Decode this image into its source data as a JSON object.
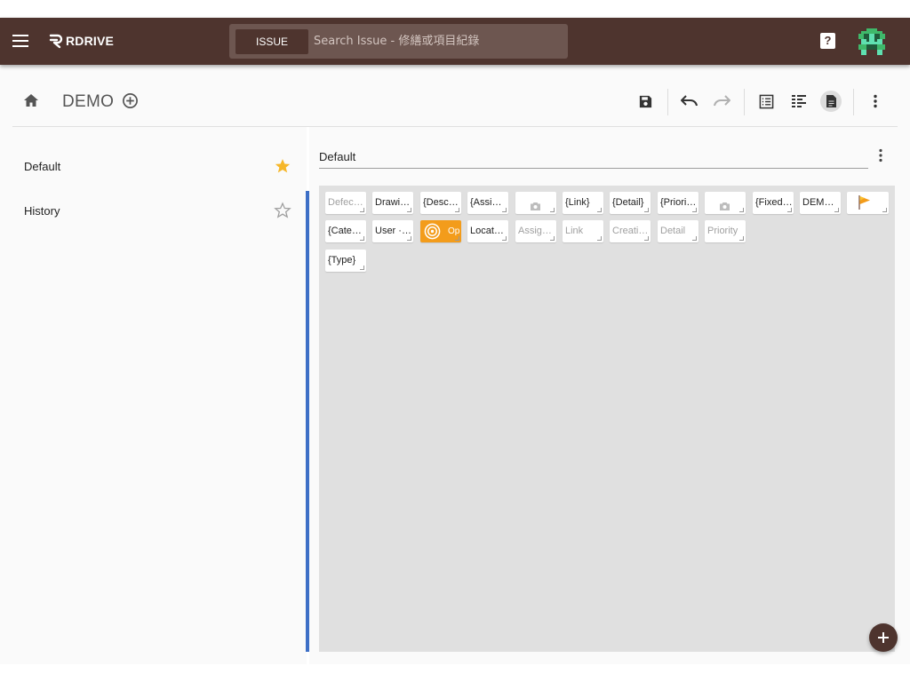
{
  "colors": {
    "appbar": "#4e342e",
    "accent_star": "#f6b72a",
    "divider": "#3d6fc6",
    "fab": "#4e342e",
    "orange_card": "#f39c1b"
  },
  "appbar": {
    "logo_text": "RDRIVE",
    "search": {
      "type_label": "ISSUE",
      "placeholder": "Search Issue - 修繕或項目紀錄"
    },
    "help_label": "?"
  },
  "project": {
    "title": "DEMO"
  },
  "toolbar": {
    "icons": [
      "save-icon",
      "undo-icon",
      "redo-icon",
      "list-view-icon",
      "detail-view-icon",
      "document-view-icon",
      "more-vert-icon"
    ]
  },
  "sidebar": {
    "items": [
      {
        "label": "Default",
        "starred": true
      },
      {
        "label": "History",
        "starred": false
      }
    ]
  },
  "main": {
    "tab_label": "Default",
    "cards": [
      {
        "label": "Defec…",
        "muted": true
      },
      {
        "label": "Drawi…",
        "muted": false
      },
      {
        "label": "{Desc…",
        "muted": false
      },
      {
        "label": "{Assi…",
        "muted": false
      },
      {
        "label": "",
        "icon": "camera-icon",
        "muted": true
      },
      {
        "label": "{Link}",
        "muted": false
      },
      {
        "label": "{Detail}",
        "muted": false
      },
      {
        "label": "{Priori…",
        "muted": false
      },
      {
        "label": "",
        "icon": "camera-icon",
        "muted": true
      },
      {
        "label": "{Fixed…",
        "muted": false
      },
      {
        "label": "DEM…",
        "muted": false
      },
      {
        "label": "",
        "icon": "flag-icon",
        "muted": false
      },
      {
        "label": "{Cate…",
        "muted": false
      },
      {
        "label": "User ·…",
        "muted": false
      },
      {
        "label": "Op",
        "icon": "target-icon",
        "muted": false,
        "highlight": "orange"
      },
      {
        "label": "Locat…",
        "muted": false
      },
      {
        "label": "Assig…",
        "muted": true
      },
      {
        "label": "Link",
        "muted": true
      },
      {
        "label": "Creati…",
        "muted": true
      },
      {
        "label": "Detail",
        "muted": true
      },
      {
        "label": "Priority",
        "muted": true
      },
      {
        "label": "{Type}",
        "muted": false
      }
    ]
  }
}
